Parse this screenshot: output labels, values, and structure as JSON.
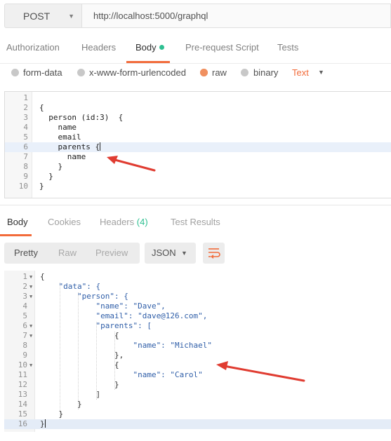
{
  "request": {
    "method": "POST",
    "url": "http://localhost:5000/graphql"
  },
  "request_tabs": {
    "authorization": "Authorization",
    "headers": "Headers",
    "body": "Body",
    "prerequest": "Pre-request Script",
    "tests": "Tests"
  },
  "body_types": {
    "form_data": "form-data",
    "urlencoded": "x-www-form-urlencoded",
    "raw": "raw",
    "binary": "binary",
    "text_select": "Text"
  },
  "request_code": [
    {
      "n": "1",
      "code": ""
    },
    {
      "n": "2",
      "code": "{"
    },
    {
      "n": "3",
      "code": "  person (id:3)  {"
    },
    {
      "n": "4",
      "code": "    name"
    },
    {
      "n": "5",
      "code": "    email"
    },
    {
      "n": "6",
      "code": "    parents {"
    },
    {
      "n": "7",
      "code": "      name"
    },
    {
      "n": "8",
      "code": "    }"
    },
    {
      "n": "9",
      "code": "  }"
    },
    {
      "n": "10",
      "code": "}"
    }
  ],
  "response_tabs": {
    "body": "Body",
    "cookies": "Cookies",
    "headers": "Headers",
    "headers_count": "(4)",
    "test_results": "Test Results"
  },
  "response_toolbar": {
    "pretty": "Pretty",
    "raw": "Raw",
    "preview": "Preview",
    "format": "JSON"
  },
  "response_code": [
    {
      "n": "1",
      "text": "{"
    },
    {
      "n": "2",
      "text": "    \"data\": {"
    },
    {
      "n": "3",
      "text": "        \"person\": {"
    },
    {
      "n": "4",
      "text": "            \"name\": \"Dave\","
    },
    {
      "n": "5",
      "text": "            \"email\": \"dave@126.com\","
    },
    {
      "n": "6",
      "text": "            \"parents\": ["
    },
    {
      "n": "7",
      "text": "                {"
    },
    {
      "n": "8",
      "text": "                    \"name\": \"Michael\""
    },
    {
      "n": "9",
      "text": "                },"
    },
    {
      "n": "10",
      "text": "                {"
    },
    {
      "n": "11",
      "text": "                    \"name\": \"Carol\""
    },
    {
      "n": "12",
      "text": "                }"
    },
    {
      "n": "13",
      "text": "            ]"
    },
    {
      "n": "14",
      "text": "        }"
    },
    {
      "n": "15",
      "text": "    }"
    },
    {
      "n": "16",
      "text": "}"
    }
  ],
  "colors": {
    "accent": "#f26b3a",
    "dot": "#2ebf91",
    "annotation_arrow": "#e03c31"
  }
}
